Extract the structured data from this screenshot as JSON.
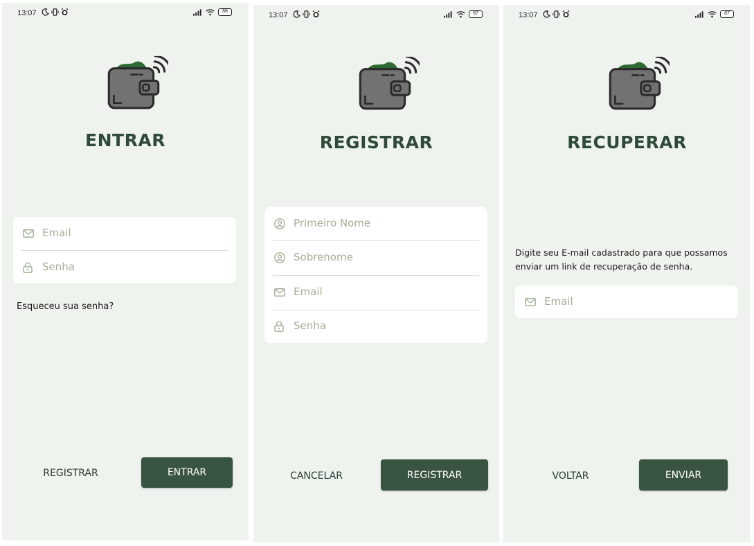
{
  "colors": {
    "background": "#eef3ee",
    "primary": "#3a5442",
    "title": "#2f4a38",
    "placeholder": "#a4ae97",
    "card": "#ffffff"
  },
  "status_bar": {
    "time": "13:07",
    "battery_login": "88",
    "battery_register": "87",
    "battery_recover": "87"
  },
  "login": {
    "title": "ENTRAR",
    "email_placeholder": "Email",
    "password_placeholder": "Senha",
    "forgot_password": "Esqueceu sua senha?",
    "secondary_button": "REGISTRAR",
    "primary_button": "ENTRAR"
  },
  "register": {
    "title": "REGISTRAR",
    "first_name_placeholder": "Primeiro Nome",
    "last_name_placeholder": "Sobrenome",
    "email_placeholder": "Email",
    "password_placeholder": "Senha",
    "secondary_button": "CANCELAR",
    "primary_button": "REGISTRAR"
  },
  "recover": {
    "title": "RECUPERAR",
    "description": "Digite seu E-mail cadastrado para que possamos enviar um link de recuperação de senha.",
    "email_placeholder": "Email",
    "secondary_button": "VOLTAR",
    "primary_button": "ENVIAR"
  },
  "icons": [
    "moon-icon",
    "vibrate-icon",
    "alarm-icon",
    "signal-icon",
    "wifi-icon",
    "battery-icon",
    "wallet-logo-icon",
    "mail-icon",
    "lock-icon",
    "user-icon"
  ]
}
